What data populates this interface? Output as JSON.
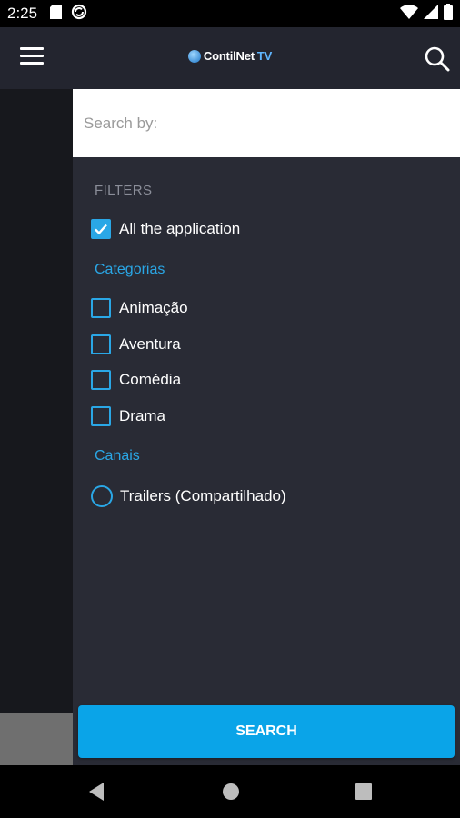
{
  "status_bar": {
    "time": "2:25",
    "icons": [
      "sd-card-icon",
      "sync-icon",
      "wifi-icon",
      "signal-icon",
      "battery-icon"
    ]
  },
  "app_bar": {
    "logo_text": "ContilNet",
    "logo_suffix": "TV",
    "menu_icon": "hamburger-menu-icon",
    "search_icon": "search-icon"
  },
  "search": {
    "placeholder": "Search by:",
    "value": ""
  },
  "filters": {
    "title": "FILTERS",
    "all_app": {
      "label": "All the application",
      "checked": true
    },
    "categorias": {
      "title": "Categorias",
      "items": [
        {
          "label": "Animação",
          "checked": false
        },
        {
          "label": "Aventura",
          "checked": false
        },
        {
          "label": "Comédia",
          "checked": false
        },
        {
          "label": "Drama",
          "checked": false
        }
      ]
    },
    "canais": {
      "title": "Canais",
      "items": [
        {
          "label": "Trailers (Compartilhado)",
          "selected": false
        }
      ]
    }
  },
  "actions": {
    "search_label": "SEARCH"
  },
  "colors": {
    "accent": "#2aa7e6",
    "button": "#0aa4e8",
    "panel": "#292b35",
    "app_bar": "#23252f"
  }
}
